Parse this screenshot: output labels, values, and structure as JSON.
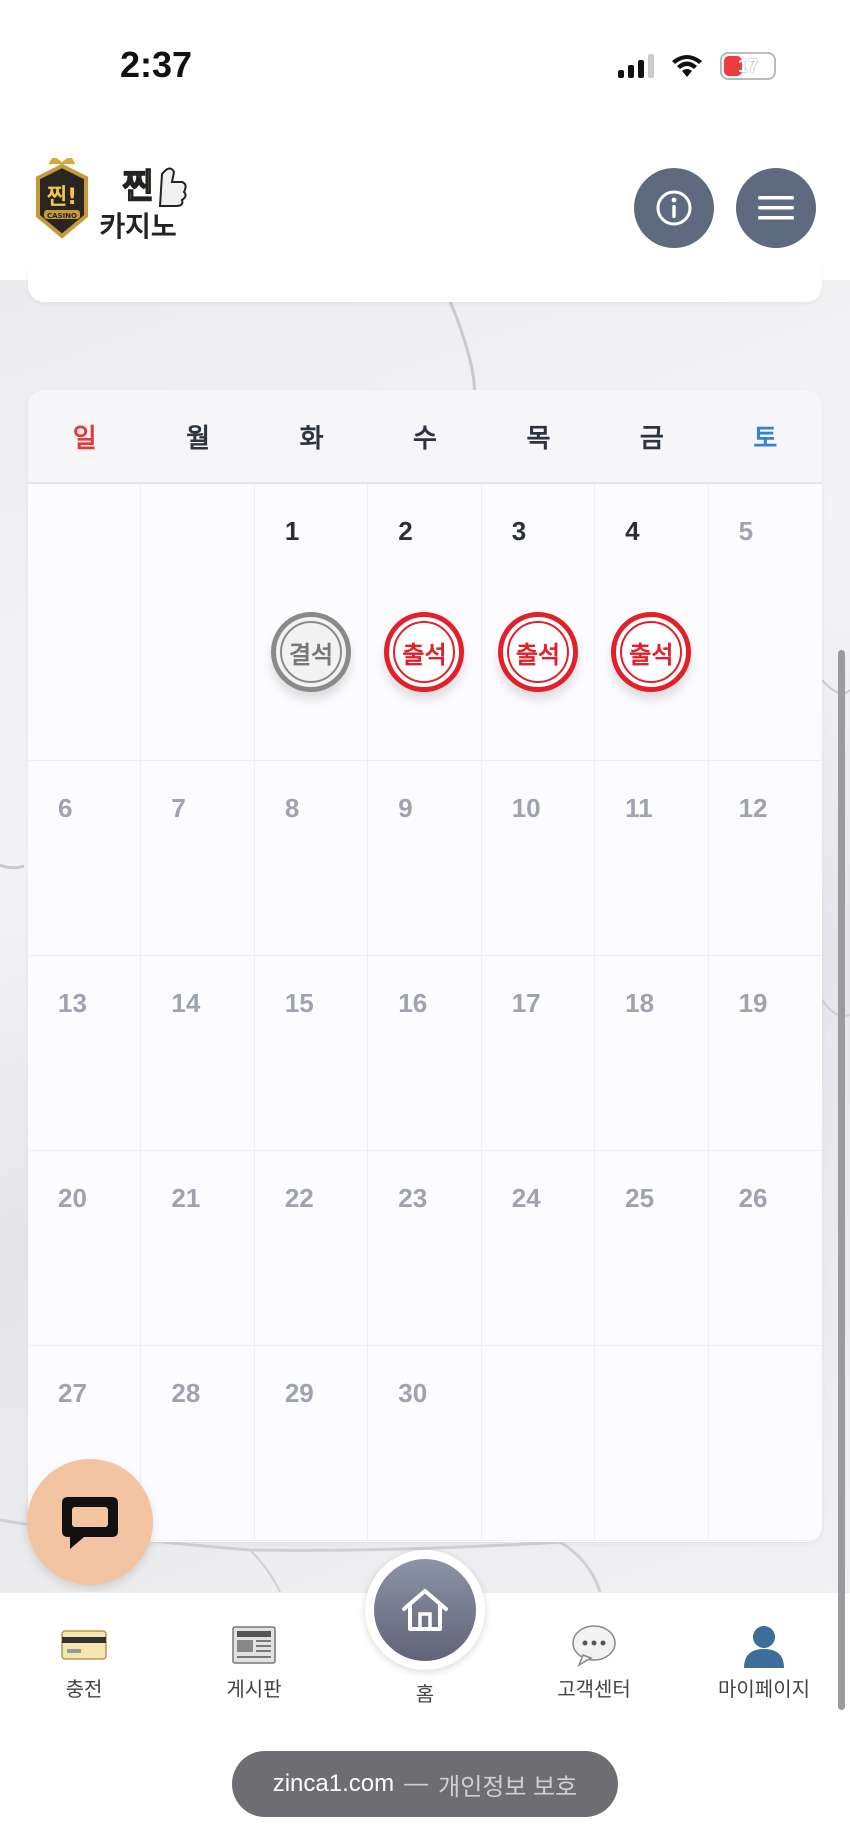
{
  "status_bar": {
    "time": "2:37",
    "battery": "17"
  },
  "header": {
    "logo_text_line1": "찐!",
    "logo_text_line2": "카지노",
    "logo_badge": "CASINO"
  },
  "calendar": {
    "weekdays": [
      "일",
      "월",
      "화",
      "수",
      "목",
      "금",
      "토"
    ],
    "stamp_labels": {
      "present": "출석",
      "absent": "결석"
    },
    "weeks": [
      [
        {
          "day": "",
          "stamp": ""
        },
        {
          "day": "",
          "stamp": ""
        },
        {
          "day": "1",
          "stamp": "absent"
        },
        {
          "day": "2",
          "stamp": "present"
        },
        {
          "day": "3",
          "stamp": "present"
        },
        {
          "day": "4",
          "stamp": "present"
        },
        {
          "day": "5",
          "stamp": ""
        }
      ],
      [
        {
          "day": "6"
        },
        {
          "day": "7"
        },
        {
          "day": "8"
        },
        {
          "day": "9"
        },
        {
          "day": "10"
        },
        {
          "day": "11"
        },
        {
          "day": "12"
        }
      ],
      [
        {
          "day": "13"
        },
        {
          "day": "14"
        },
        {
          "day": "15"
        },
        {
          "day": "16"
        },
        {
          "day": "17"
        },
        {
          "day": "18"
        },
        {
          "day": "19"
        }
      ],
      [
        {
          "day": "20"
        },
        {
          "day": "21"
        },
        {
          "day": "22"
        },
        {
          "day": "23"
        },
        {
          "day": "24"
        },
        {
          "day": "25"
        },
        {
          "day": "26"
        }
      ],
      [
        {
          "day": "27"
        },
        {
          "day": "28"
        },
        {
          "day": "29"
        },
        {
          "day": "30"
        },
        {
          "day": ""
        },
        {
          "day": ""
        },
        {
          "day": ""
        }
      ]
    ],
    "active_days": [
      "1",
      "2",
      "3",
      "4"
    ]
  },
  "bottom_nav": {
    "items": [
      {
        "label": "충전",
        "icon": "credit-card-icon"
      },
      {
        "label": "게시판",
        "icon": "newspaper-icon"
      },
      {
        "label": "홈",
        "icon": "home-icon"
      },
      {
        "label": "고객센터",
        "icon": "speech-bubble-icon"
      },
      {
        "label": "마이페이지",
        "icon": "user-icon"
      }
    ]
  },
  "browser": {
    "domain": "zinca1.com",
    "dash": "—",
    "privacy": "개인정보 보호"
  },
  "colors": {
    "header_button": "#5e6a80",
    "stamp_present": "#e3202a",
    "stamp_absent": "#8a8a8a",
    "sunday": "#e53838",
    "saturday": "#3b7fd9",
    "chat_button": "#f3c4a2"
  }
}
